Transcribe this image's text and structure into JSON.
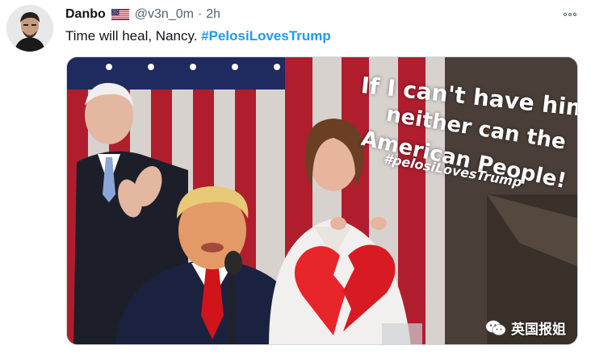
{
  "tweet": {
    "author": {
      "display_name": "Danbo",
      "flag": "us-flag-icon",
      "handle": "@v3n_0m",
      "separator": "·",
      "time": "2h"
    },
    "text": {
      "body": "Time will heal, Nancy. ",
      "hashtag": "#PelosiLovesTrump"
    },
    "media": {
      "overlay_lines": [
        "If I can't have him,",
        "neither can the",
        "American People!",
        "#pelosiLovesTrump"
      ],
      "watermark": "英国报姐"
    }
  },
  "colors": {
    "link": "#1d9bf0",
    "secondary_text": "#536471",
    "primary_text": "#0f1419"
  }
}
